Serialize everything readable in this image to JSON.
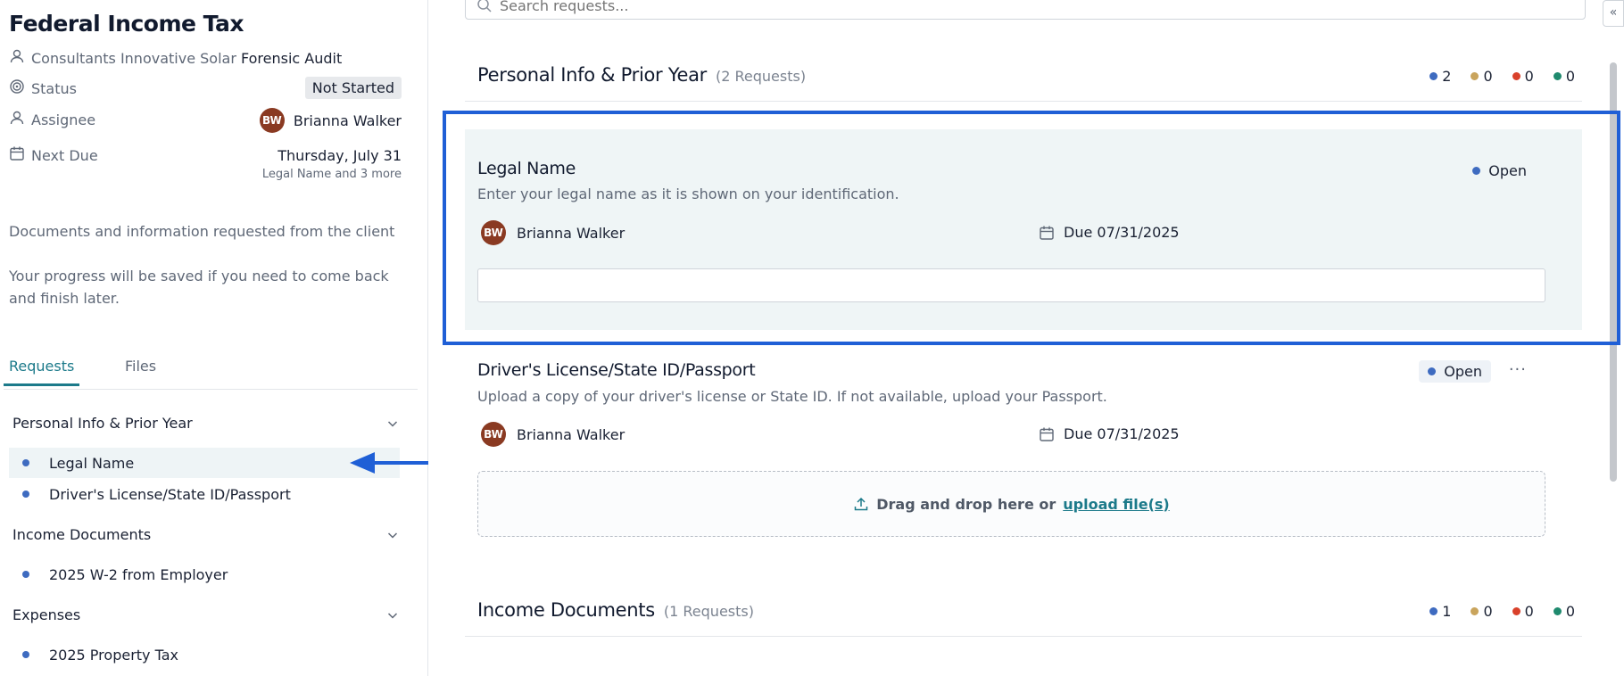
{
  "sidebar": {
    "title": "Federal Income Tax",
    "client": {
      "label": "Consultants Innovative Solar",
      "value": "Forensic Audit"
    },
    "status": {
      "label": "Status",
      "value": "Not Started"
    },
    "assignee": {
      "label": "Assignee",
      "initials": "BW",
      "name": "Brianna Walker"
    },
    "next_due": {
      "label": "Next Due",
      "value": "Thursday, July 31",
      "sub": "Legal Name and 3 more"
    },
    "desc1": "Documents and information requested from the client",
    "desc2": "Your progress will be saved if you need to come back and finish later.",
    "tabs": [
      {
        "label": "Requests"
      },
      {
        "label": "Files"
      }
    ],
    "groups": [
      {
        "label": "Personal Info & Prior Year",
        "items": [
          "Legal Name",
          "Driver's License/State ID/Passport"
        ]
      },
      {
        "label": "Income Documents",
        "items": [
          "2025 W-2 from Employer"
        ]
      },
      {
        "label": "Expenses",
        "items": [
          "2025 Property Tax"
        ]
      }
    ]
  },
  "main": {
    "search_placeholder": "Search requests...",
    "sections": [
      {
        "title": "Personal Info & Prior Year",
        "count": "(2 Requests)",
        "counts": [
          "2",
          "0",
          "0",
          "0"
        ]
      },
      {
        "title": "Income Documents",
        "count": "(1 Requests)",
        "counts": [
          "1",
          "0",
          "0",
          "0"
        ]
      }
    ],
    "cards": [
      {
        "title": "Legal Name",
        "description": "Enter your legal name as it is shown on your identification.",
        "status": "Open",
        "assignee_initials": "BW",
        "assignee": "Brianna Walker",
        "due": "Due 07/31/2025"
      },
      {
        "title": "Driver's License/State ID/Passport",
        "description": "Upload a copy of your driver's license or State ID. If not available, upload your Passport.",
        "status": "Open",
        "more": "···",
        "assignee_initials": "BW",
        "assignee": "Brianna Walker",
        "due": "Due 07/31/2025",
        "drop_text": "Drag and drop here or",
        "upload_link": "upload file(s)"
      }
    ]
  },
  "colors": {
    "accent": "#1c7a8a",
    "open": "#3e6bc0",
    "pending": "#c9a45c",
    "rejected": "#d9412b",
    "done": "#1f8a6e",
    "highlight": "#1f5fd6"
  },
  "collapse_label": "«"
}
